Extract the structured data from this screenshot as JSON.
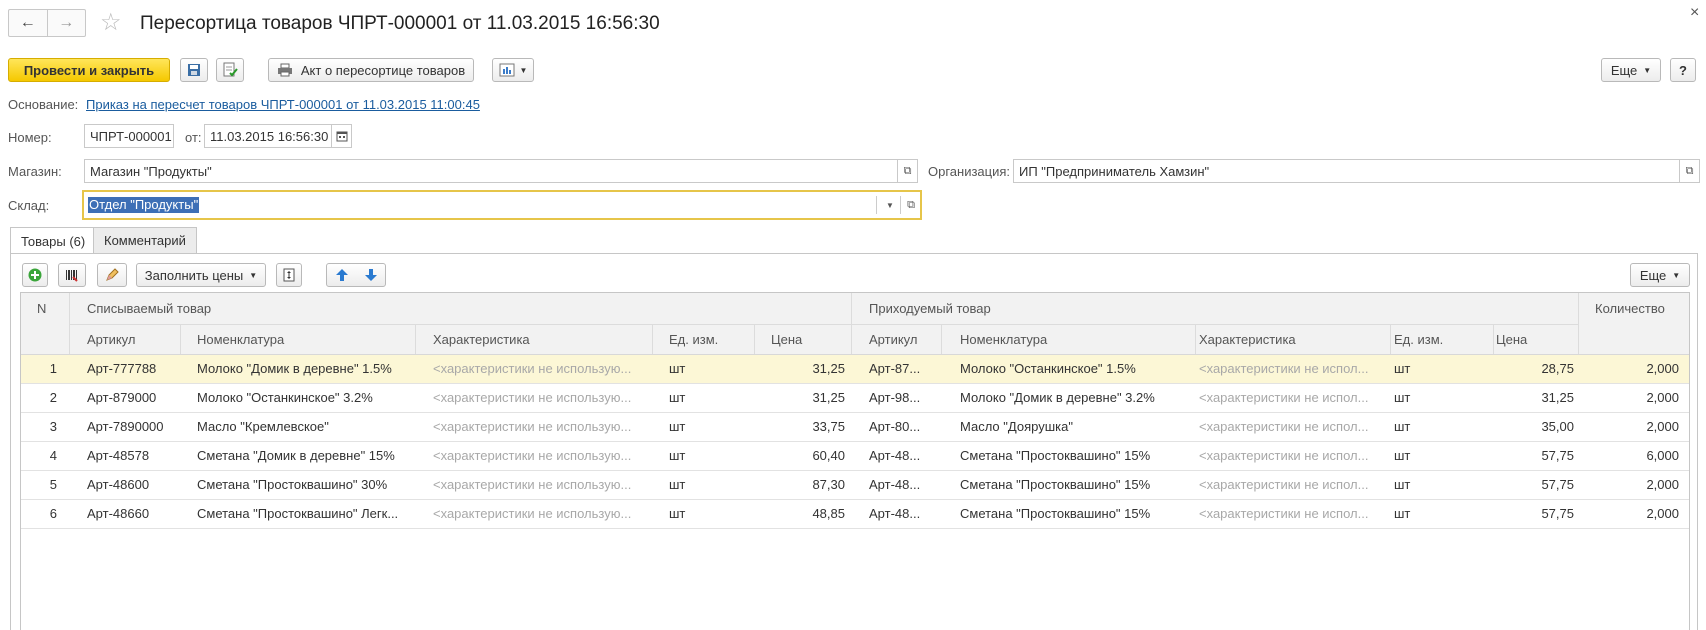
{
  "window": {
    "title": "Пересортица товаров ЧПРТ-000001 от 11.03.2015 16:56:30",
    "close": "×"
  },
  "toolbar": {
    "post_close": "Провести и закрыть",
    "act_print": "Акт о пересортице товаров",
    "more": "Еще",
    "help": "?"
  },
  "form": {
    "basis_label": "Основание:",
    "basis_link": "Приказ на пересчет товаров ЧПРТ-000001 от 11.03.2015 11:00:45",
    "number_label": "Номер:",
    "number_value": "ЧПРТ-000001",
    "date_label": "от:",
    "date_value": "11.03.2015 16:56:30",
    "store_label": "Магазин:",
    "store_value": "Магазин \"Продукты\"",
    "org_label": "Организация:",
    "org_value": "ИП \"Предприниматель Хамзин\"",
    "warehouse_label": "Склад:",
    "warehouse_value": "Отдел \"Продукты\""
  },
  "tabs": [
    {
      "label": "Товары (6)",
      "active": true
    },
    {
      "label": "Комментарий",
      "active": false
    }
  ],
  "table_toolbar": {
    "fill_prices": "Заполнить цены",
    "more": "Еще"
  },
  "table": {
    "col_n": "N",
    "group_out": "Списываемый товар",
    "group_in": "Приходуемый товар",
    "col_qty": "Количество",
    "sub": {
      "article": "Артикул",
      "nomenclature": "Номенклатура",
      "characteristic": "Характеристика",
      "unit": "Ед. изм.",
      "price": "Цена"
    },
    "rows": [
      {
        "n": "1",
        "out_art": "Арт-777788",
        "out_nom": "Молоко \"Домик в деревне\" 1.5%",
        "out_char": "<характеристики не использую...",
        "out_unit": "шт",
        "out_price": "31,25",
        "in_art": "Арт-87...",
        "in_nom": "Молоко \"Останкинское\" 1.5%",
        "in_char": "<характеристики не испол...",
        "in_unit": "шт",
        "in_price": "28,75",
        "qty": "2,000"
      },
      {
        "n": "2",
        "out_art": "Арт-879000",
        "out_nom": "Молоко \"Останкинское\" 3.2%",
        "out_char": "<характеристики не использую...",
        "out_unit": "шт",
        "out_price": "31,25",
        "in_art": "Арт-98...",
        "in_nom": "Молоко \"Домик в деревне\" 3.2%",
        "in_char": "<характеристики не испол...",
        "in_unit": "шт",
        "in_price": "31,25",
        "qty": "2,000"
      },
      {
        "n": "3",
        "out_art": "Арт-7890000",
        "out_nom": "Масло \"Кремлевское\"",
        "out_char": "<характеристики не использую...",
        "out_unit": "шт",
        "out_price": "33,75",
        "in_art": "Арт-80...",
        "in_nom": "Масло \"Доярушка\"",
        "in_char": "<характеристики не испол...",
        "in_unit": "шт",
        "in_price": "35,00",
        "qty": "2,000"
      },
      {
        "n": "4",
        "out_art": "Арт-48578",
        "out_nom": "Сметана \"Домик в деревне\" 15%",
        "out_char": "<характеристики не использую...",
        "out_unit": "шт",
        "out_price": "60,40",
        "in_art": "Арт-48...",
        "in_nom": "Сметана \"Простоквашино\" 15%",
        "in_char": "<характеристики не испол...",
        "in_unit": "шт",
        "in_price": "57,75",
        "qty": "6,000"
      },
      {
        "n": "5",
        "out_art": "Арт-48600",
        "out_nom": "Сметана \"Простоквашино\" 30%",
        "out_char": "<характеристики не использую...",
        "out_unit": "шт",
        "out_price": "87,30",
        "in_art": "Арт-48...",
        "in_nom": "Сметана \"Простоквашино\" 15%",
        "in_char": "<характеристики не испол...",
        "in_unit": "шт",
        "in_price": "57,75",
        "qty": "2,000"
      },
      {
        "n": "6",
        "out_art": "Арт-48660",
        "out_nom": "Сметана \"Простоквашино\" Легк...",
        "out_char": "<характеристики не использую...",
        "out_unit": "шт",
        "out_price": "48,85",
        "in_art": "Арт-48...",
        "in_nom": "Сметана \"Простоквашино\" 15%",
        "in_char": "<характеристики не испол...",
        "in_unit": "шт",
        "in_price": "57,75",
        "qty": "2,000"
      }
    ]
  },
  "colors": {
    "accent_yellow": "#f5c800",
    "selected_row": "#fcf7d6",
    "link": "#1a5c9e",
    "focus_border": "#e6c54a"
  }
}
